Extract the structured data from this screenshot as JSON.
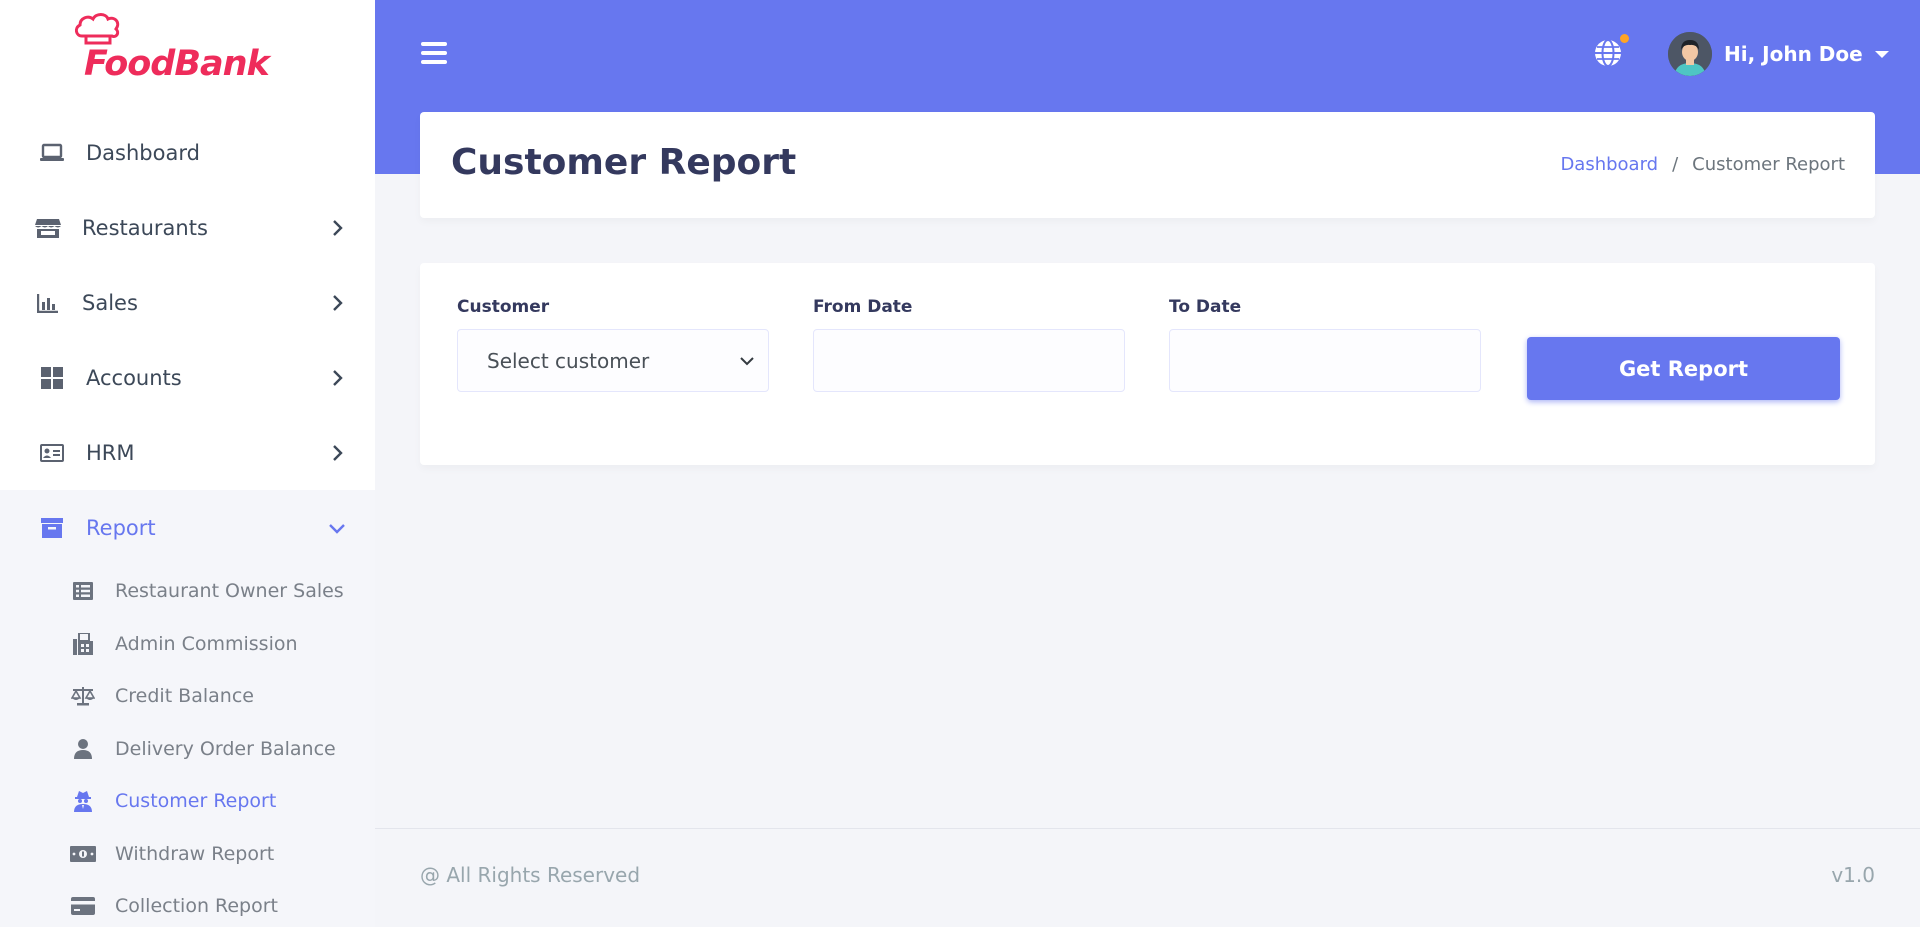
{
  "brand": {
    "name": "FoodBank"
  },
  "sidebar": {
    "items": [
      {
        "label": "Dashboard",
        "icon": "laptop-icon"
      },
      {
        "label": "Restaurants",
        "icon": "store-icon"
      },
      {
        "label": "Sales",
        "icon": "chart-bar-icon"
      },
      {
        "label": "Accounts",
        "icon": "grid-icon"
      },
      {
        "label": "HRM",
        "icon": "id-card-icon"
      },
      {
        "label": "Report",
        "icon": "archive-icon",
        "expanded": true
      }
    ],
    "report_subitems": [
      {
        "label": "Restaurant Owner Sales",
        "icon": "list-icon"
      },
      {
        "label": "Admin Commission",
        "icon": "fax-icon"
      },
      {
        "label": "Credit Balance",
        "icon": "balance-scale-icon"
      },
      {
        "label": "Delivery Order Balance",
        "icon": "user-icon"
      },
      {
        "label": "Customer Report",
        "icon": "user-secret-icon",
        "active": true
      },
      {
        "label": "Withdraw Report",
        "icon": "money-bill-icon"
      },
      {
        "label": "Collection Report",
        "icon": "credit-card-icon"
      }
    ]
  },
  "header": {
    "user_greeting": "Hi, John Doe",
    "notification_color": "#ffa426"
  },
  "page": {
    "title": "Customer Report",
    "breadcrumb": {
      "home": "Dashboard",
      "separator": "/",
      "current": "Customer Report"
    }
  },
  "form": {
    "customer_label": "Customer",
    "customer_value": "Select customer",
    "from_date_label": "From Date",
    "from_date_value": "",
    "to_date_label": "To Date",
    "to_date_value": "",
    "submit_label": "Get Report"
  },
  "footer": {
    "copyright": "@ All Rights Reserved",
    "version": "v1.0"
  },
  "colors": {
    "primary": "#6777ef",
    "brand": "#ee2c5b"
  }
}
